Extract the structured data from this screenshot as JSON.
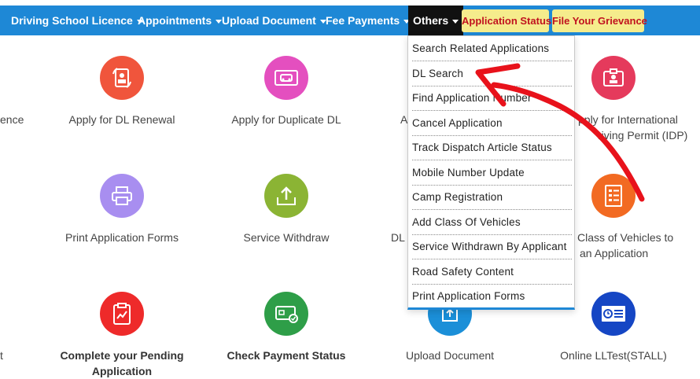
{
  "nav": {
    "partial_item": "Driving School Licence",
    "items": [
      "Appointments",
      "Upload Document",
      "Fee Payments"
    ],
    "active": "Others",
    "buttons": [
      "Application Status",
      "File Your Grievance"
    ]
  },
  "tiles": {
    "cut_left_1": "ence",
    "dl_renewal": "Apply for DL Renewal",
    "duplicate_dl": "Apply for Duplicate DL",
    "partial_col3_row1": "A",
    "idp_line1": "pply for International",
    "idp_line2": "riving Permit (IDP)",
    "print_forms": "Print Application Forms",
    "service_withdraw": "Service Withdraw",
    "partial_col3_row2": "DL",
    "class_line1": "Class of Vehicles to",
    "class_line2": "an Application",
    "cut_left_3": "t",
    "complete_pending_line1": "Complete your Pending",
    "complete_pending_line2": "Application",
    "check_payment": "Check Payment Status",
    "upload_document": "Upload Document",
    "online_lltest": "Online LLTest(STALL)"
  },
  "dropdown": {
    "items": [
      "Search Related Applications",
      "DL Search",
      "Find Application Number",
      "Cancel Application",
      "Track Dispatch Article Status",
      "Mobile Number Update",
      "Camp Registration",
      "Add Class Of Vehicles",
      "Service Withdrawn By Applicant",
      "Road Safety Content",
      "Print Application Forms"
    ]
  },
  "colors": {
    "nav_bg": "#1e88d6",
    "nav_active_bg": "#111111",
    "nav_button_bg": "#f5ec8c",
    "nav_button_text": "#c1121f",
    "annotation_arrow": "#e8121b",
    "icon_renewal": "#f0553c",
    "icon_duplicate": "#e44fbf",
    "icon_idp": "#e53a5c",
    "icon_print": "#a88ef0",
    "icon_withdraw": "#8bb434",
    "icon_class": "#f26a22",
    "icon_pending": "#ee2a2a",
    "icon_payment": "#2e9e48",
    "icon_upload": "#1b8fd8",
    "icon_lltest": "#1546c4"
  }
}
